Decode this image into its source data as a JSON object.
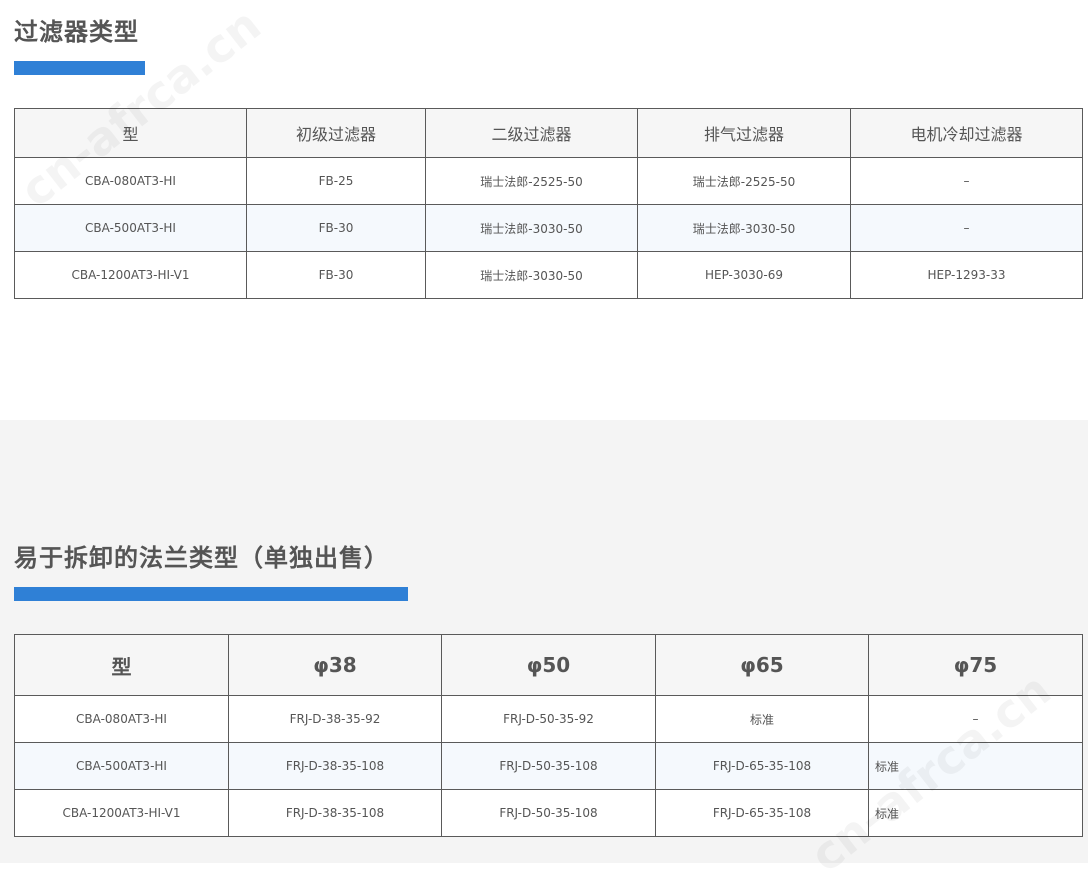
{
  "section1": {
    "title": "过滤器类型",
    "headers": [
      "型",
      "初级过滤器",
      "二级过滤器",
      "排气过滤器",
      "电机冷却过滤器"
    ],
    "rows": [
      [
        "CBA-080AT3-HI",
        "FB-25",
        "瑞士法郎-2525-50",
        "瑞士法郎-2525-50",
        "–"
      ],
      [
        "CBA-500AT3-HI",
        "FB-30",
        "瑞士法郎-3030-50",
        "瑞士法郎-3030-50",
        "–"
      ],
      [
        "CBA-1200AT3-HI-V1",
        "FB-30",
        "瑞士法郎-3030-50",
        "HEP-3030-69",
        "HEP-1293-33"
      ]
    ]
  },
  "section2": {
    "title": "易于拆卸的法兰类型（单独出售）",
    "headers": [
      "型",
      "φ38",
      "φ50",
      "φ65",
      "φ75"
    ],
    "rows": [
      [
        "CBA-080AT3-HI",
        "FRJ-D-38-35-92",
        "FRJ-D-50-35-92",
        "标准",
        "–"
      ],
      [
        "CBA-500AT3-HI",
        "FRJ-D-38-35-108",
        "FRJ-D-50-35-108",
        "FRJ-D-65-35-108",
        "标准"
      ],
      [
        "CBA-1200AT3-HI-V1",
        "FRJ-D-38-35-108",
        "FRJ-D-50-35-108",
        "FRJ-D-65-35-108",
        "标准"
      ]
    ]
  },
  "watermark": "cn-afrca.cn",
  "colors": {
    "accent_bar": "#2f80d6",
    "title_text": "#555555",
    "section2_background": "#f4f4f4",
    "row_alt_background": "#f5f9fd",
    "table_border": "#5a5a5a"
  }
}
